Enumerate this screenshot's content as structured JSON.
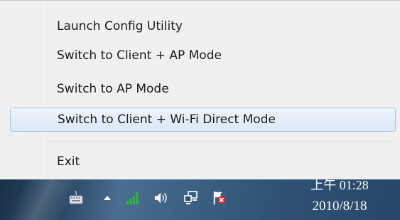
{
  "context_menu": {
    "items": [
      {
        "label": "Launch Config Utility"
      },
      {
        "label": "Switch to Client + AP Mode"
      },
      {
        "label": "Switch to AP Mode"
      },
      {
        "label": "Switch to Client + Wi-Fi Direct Mode",
        "highlighted": true
      }
    ],
    "exit_label": "Exit"
  },
  "taskbar": {
    "tray_icons": [
      "keyboard-icon",
      "show-hidden-icons-arrow",
      "wifi-signal-icon",
      "speaker-icon",
      "network-icon",
      "action-center-flag-icon"
    ],
    "clock": {
      "time": "上午 01:28",
      "date": "2010/8/18"
    }
  },
  "colors": {
    "menu_background": "#f0f0f0",
    "highlight_border": "#a9c3e2",
    "signal_green": "#22c322",
    "error_red": "#d9262c"
  }
}
